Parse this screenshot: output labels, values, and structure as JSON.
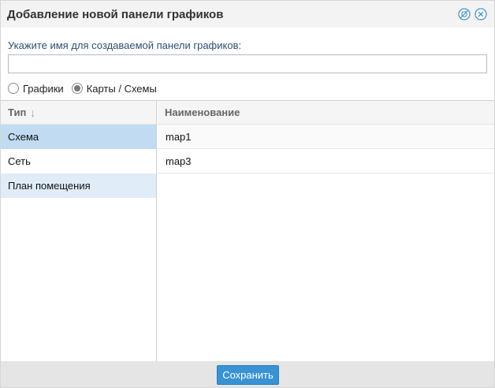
{
  "dialog": {
    "title": "Добавление новой панели графиков",
    "pin_icon": "pin-icon",
    "close_icon": "close-icon"
  },
  "form": {
    "prompt": "Укажите имя для создаваемой панели графиков:",
    "name_value": "",
    "name_placeholder": "",
    "radio_options": [
      {
        "label": "Графики",
        "checked": false
      },
      {
        "label": "Карты / Схемы",
        "checked": true
      }
    ]
  },
  "type_grid": {
    "header": "Тип",
    "sort_icon": "sort-down-arrow-icon",
    "rows": [
      {
        "label": "Схема",
        "selected": true
      },
      {
        "label": "Сеть",
        "selected": false
      },
      {
        "label": "План помещения",
        "selected": false
      }
    ]
  },
  "name_grid": {
    "header": "Наименование",
    "rows": [
      {
        "label": "map1"
      },
      {
        "label": "map3"
      }
    ]
  },
  "footer": {
    "save_label": "Сохранить"
  },
  "colors": {
    "accent": "#3892d3",
    "selected_row": "#c1dcf2",
    "alt_row": "#e0ecf8",
    "prompt_text": "#2d4f73"
  }
}
